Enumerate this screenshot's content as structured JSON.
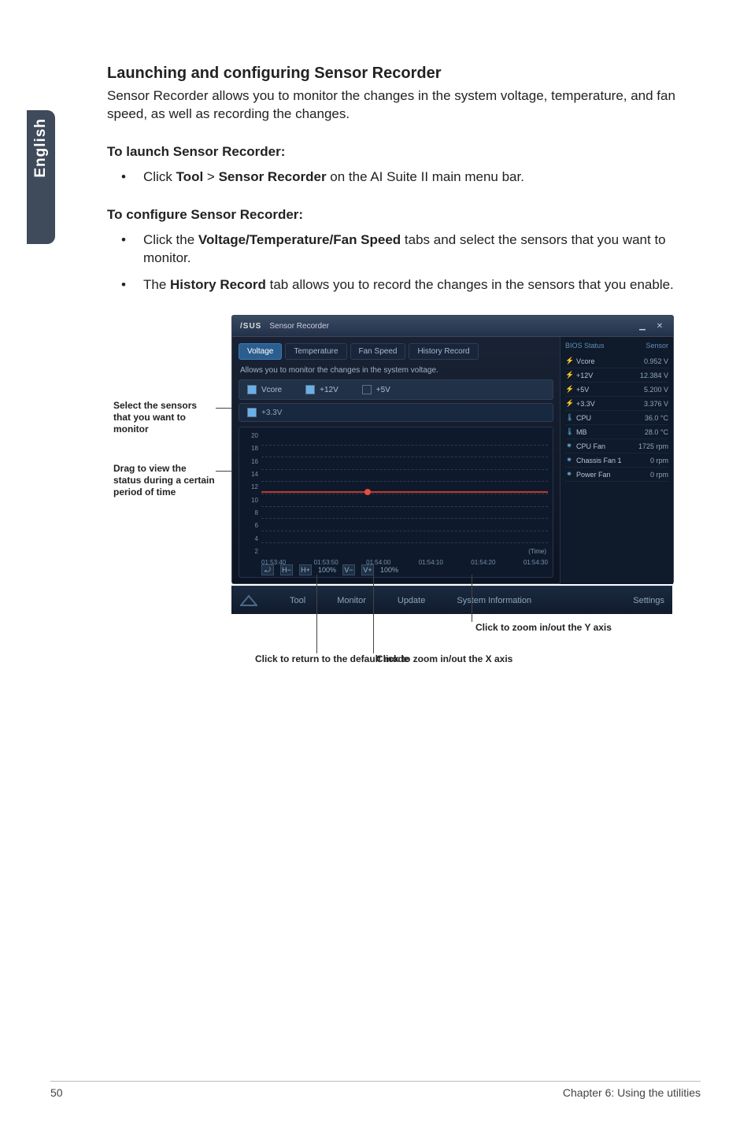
{
  "sidebar_tab": "English",
  "heading": "Launching and configuring Sensor Recorder",
  "intro": "Sensor Recorder allows you to monitor the changes in the system voltage, temperature, and fan speed, as well as recording the changes.",
  "launch_heading": "To launch Sensor Recorder:",
  "launch_item_pre": "Click ",
  "launch_tool": "Tool",
  "launch_gt": " > ",
  "launch_sr": "Sensor Recorder",
  "launch_item_post": " on the AI Suite II main menu bar.",
  "config_heading": "To configure Sensor Recorder:",
  "config_item1_pre": "Click the ",
  "config_item1_bold": "Voltage/Temperature/Fan Speed",
  "config_item1_post": " tabs and select the sensors that you want to monitor.",
  "config_item2_pre": "The ",
  "config_item2_bold": "History Record",
  "config_item2_post": " tab allows you to record the changes in the sensors that you enable.",
  "labels": {
    "select_sensors": "Select the sensors that you want to monitor",
    "drag_status": "Drag to view the status during a certain period of time",
    "zoom_y": "Click to zoom in/out the Y axis",
    "zoom_x": "Click to zoom in/out the X axis",
    "return_default": "Click to return to the default mode"
  },
  "window": {
    "brand": "/SUS",
    "title": "Sensor Recorder",
    "tabs": {
      "voltage": "Voltage",
      "temperature": "Temperature",
      "fan": "Fan Speed",
      "history": "History Record"
    },
    "hint": "Allows you to monitor the changes in the system voltage.",
    "checks": {
      "vcore": "Vcore",
      "p12v": "+12V",
      "p5v": "+5V"
    },
    "check2": "+3.3V",
    "yticks": [
      "20",
      "18",
      "16",
      "14",
      "12",
      "10",
      "8",
      "6",
      "4",
      "2"
    ],
    "xticks": [
      "01:53:40",
      "01:53:50",
      "01:54:00",
      "01:54:10",
      "01:54:20",
      "01:54:30"
    ],
    "time_label": "(Time)",
    "zoom_h": "100%",
    "zoom_v": "100%",
    "side_header_l": "BIOS Status",
    "side_header_r": "Sensor",
    "sensors": [
      {
        "icon": "⚡",
        "name": "Vcore",
        "val": "0.952 V"
      },
      {
        "icon": "⚡",
        "name": "+12V",
        "val": "12.384 V"
      },
      {
        "icon": "⚡",
        "name": "+5V",
        "val": "5.200 V"
      },
      {
        "icon": "⚡",
        "name": "+3.3V",
        "val": "3.376 V"
      },
      {
        "icon": "🌡",
        "name": "CPU",
        "val": "36.0 °C"
      },
      {
        "icon": "🌡",
        "name": "MB",
        "val": "28.0 °C"
      },
      {
        "icon": "✷",
        "name": "CPU Fan",
        "val": "1725 rpm"
      },
      {
        "icon": "✷",
        "name": "Chassis Fan 1",
        "val": "0 rpm"
      },
      {
        "icon": "✷",
        "name": "Power Fan",
        "val": "0 rpm"
      }
    ],
    "bottombar": {
      "tool": "Tool",
      "monitor": "Monitor",
      "update": "Update",
      "sysinfo": "System Information",
      "settings": "Settings"
    }
  },
  "footer": {
    "page": "50",
    "chapter": "Chapter 6: Using the utilities"
  }
}
